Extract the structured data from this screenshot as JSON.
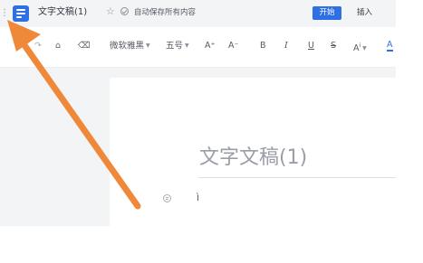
{
  "titlebar": {
    "menu_icon": "menu-icon",
    "doc_icon": "document-icon",
    "doc_title": "文字文稿(1)",
    "autosave": "自动保存所有内容",
    "tabs": [
      {
        "label": "开始",
        "active": true
      },
      {
        "label": "插入",
        "active": false
      }
    ]
  },
  "toolbar": {
    "font_name": "微软雅黑",
    "font_size": "五号",
    "increase_font": "A⁺",
    "decrease_font": "A⁻",
    "bold": "B",
    "italic": "I",
    "underline": "U",
    "strikethrough": "S",
    "superscript": "A",
    "font_color": "A"
  },
  "document": {
    "heading": "文字文稿(1)",
    "cursor_text": "ì"
  },
  "colors": {
    "accent": "#2f6fe4",
    "arrow": "#f0883a"
  }
}
